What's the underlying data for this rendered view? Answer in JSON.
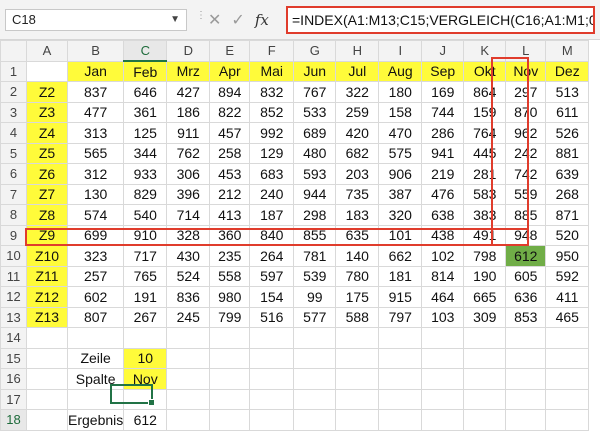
{
  "name_box": "C18",
  "formula": "=INDEX(A1:M13;C15;VERGLEICH(C16;A1:M1;0))",
  "icons": {
    "cancel": "x-icon",
    "confirm": "check-icon",
    "fx": "fx"
  },
  "columns": [
    "A",
    "B",
    "C",
    "D",
    "E",
    "F",
    "G",
    "H",
    "I",
    "J",
    "K",
    "L",
    "M"
  ],
  "rows": [
    [
      "1",
      "",
      "Jan",
      "Feb",
      "Mrz",
      "Apr",
      "Mai",
      "Jun",
      "Jul",
      "Aug",
      "Sep",
      "Okt",
      "Nov",
      "Dez"
    ],
    [
      "2",
      "Z2",
      "837",
      "646",
      "427",
      "894",
      "832",
      "767",
      "322",
      "180",
      "169",
      "864",
      "297",
      "513"
    ],
    [
      "3",
      "Z3",
      "477",
      "361",
      "186",
      "822",
      "852",
      "533",
      "259",
      "158",
      "744",
      "159",
      "870",
      "611"
    ],
    [
      "4",
      "Z4",
      "313",
      "125",
      "911",
      "457",
      "992",
      "689",
      "420",
      "470",
      "286",
      "764",
      "962",
      "526"
    ],
    [
      "5",
      "Z5",
      "565",
      "344",
      "762",
      "258",
      "129",
      "480",
      "682",
      "575",
      "941",
      "445",
      "242",
      "881"
    ],
    [
      "6",
      "Z6",
      "312",
      "933",
      "306",
      "453",
      "683",
      "593",
      "203",
      "906",
      "219",
      "281",
      "742",
      "639"
    ],
    [
      "7",
      "Z7",
      "130",
      "829",
      "396",
      "212",
      "240",
      "944",
      "735",
      "387",
      "476",
      "583",
      "559",
      "268"
    ],
    [
      "8",
      "Z8",
      "574",
      "540",
      "714",
      "413",
      "187",
      "298",
      "183",
      "320",
      "638",
      "383",
      "885",
      "871"
    ],
    [
      "9",
      "Z9",
      "699",
      "910",
      "328",
      "360",
      "840",
      "855",
      "635",
      "101",
      "438",
      "491",
      "948",
      "520"
    ],
    [
      "10",
      "Z10",
      "323",
      "717",
      "430",
      "235",
      "264",
      "781",
      "140",
      "662",
      "102",
      "798",
      "612",
      "950"
    ],
    [
      "11",
      "Z11",
      "257",
      "765",
      "524",
      "558",
      "597",
      "539",
      "780",
      "181",
      "814",
      "190",
      "605",
      "592"
    ],
    [
      "12",
      "Z12",
      "602",
      "191",
      "836",
      "980",
      "154",
      "99",
      "175",
      "915",
      "464",
      "665",
      "636",
      "411"
    ],
    [
      "13",
      "Z13",
      "807",
      "267",
      "245",
      "799",
      "516",
      "577",
      "588",
      "797",
      "103",
      "309",
      "853",
      "465"
    ],
    [
      "14",
      "",
      "",
      "",
      "",
      "",
      "",
      "",
      "",
      "",
      "",
      "",
      "",
      ""
    ],
    [
      "15",
      "",
      "Zeile",
      "10",
      "",
      "",
      "",
      "",
      "",
      "",
      "",
      "",
      "",
      ""
    ],
    [
      "16",
      "",
      "Spalte",
      "Nov",
      "",
      "",
      "",
      "",
      "",
      "",
      "",
      "",
      "",
      ""
    ],
    [
      "17",
      "",
      "",
      "",
      "",
      "",
      "",
      "",
      "",
      "",
      "",
      "",
      "",
      ""
    ],
    [
      "18",
      "",
      "Ergebnis",
      "612",
      "",
      "",
      "",
      "",
      "",
      "",
      "",
      "",
      "",
      ""
    ]
  ],
  "colors": {
    "yellow": "#fffb3a",
    "green": "#70ad47",
    "red_border": "#e03c2c",
    "selection": "#217346"
  }
}
